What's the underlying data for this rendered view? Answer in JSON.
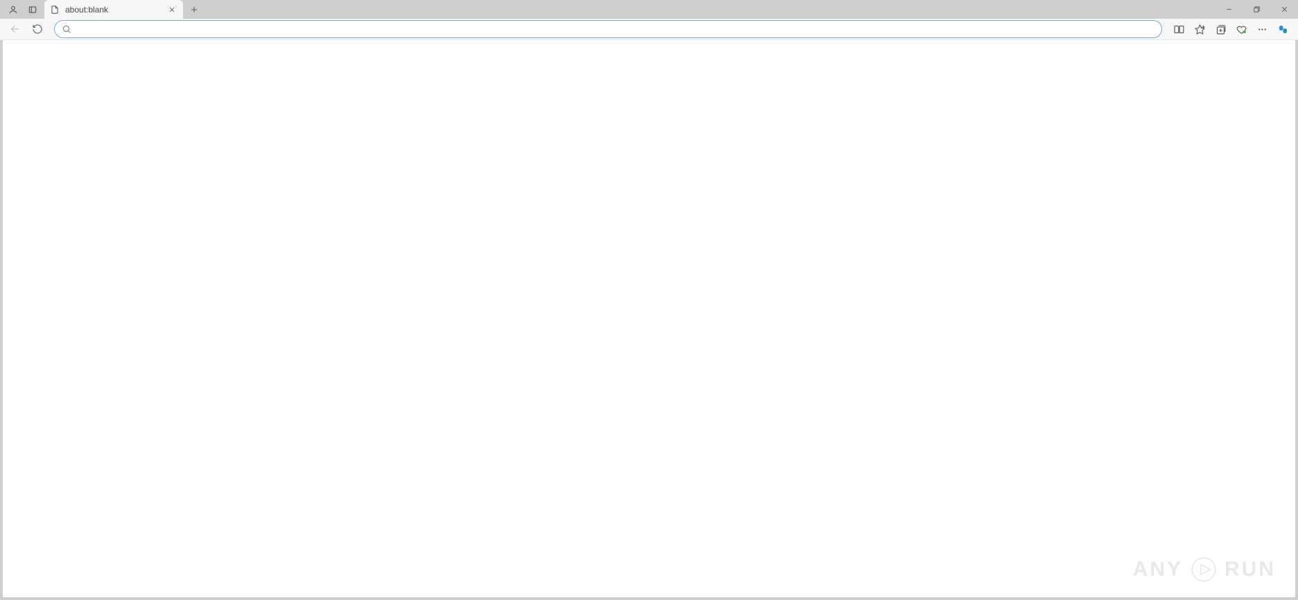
{
  "tab": {
    "title": "about:blank"
  },
  "address_bar": {
    "value": "",
    "placeholder": ""
  },
  "watermark": {
    "left": "ANY",
    "right": "RUN"
  }
}
